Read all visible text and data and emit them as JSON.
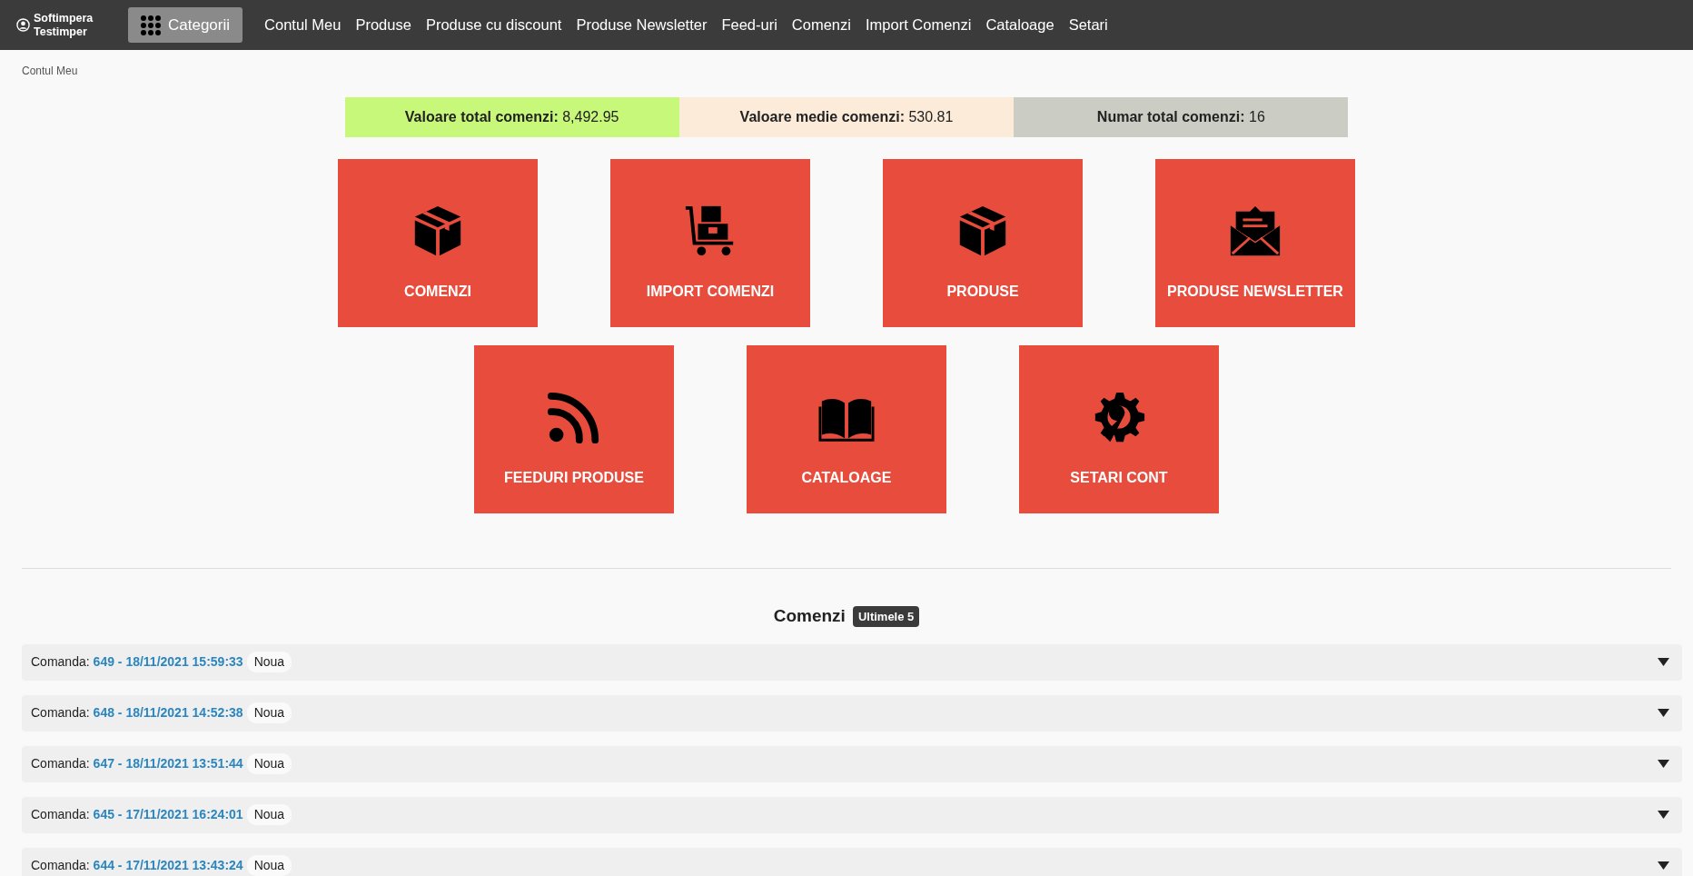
{
  "navbar": {
    "user": "Softimpera Testimper",
    "categories_button": "Categorii",
    "links": [
      "Contul Meu",
      "Produse",
      "Produse cu discount",
      "Produse Newsletter",
      "Feed-uri",
      "Comenzi",
      "Import Comenzi",
      "Cataloage",
      "Setari"
    ]
  },
  "breadcrumb": "Contul Meu",
  "stats": [
    {
      "label": "Valoare total comenzi:",
      "value": "8,492.95",
      "color": "#c8f87a"
    },
    {
      "label": "Valoare medie comenzi:",
      "value": "530.81",
      "color": "#fbebd8"
    },
    {
      "label": "Numar total comenzi:",
      "value": "16",
      "color": "#cbcdc4"
    }
  ],
  "tiles": [
    {
      "label": "COMENZI",
      "kind": "box"
    },
    {
      "label": "IMPORT COMENZI",
      "kind": "cart"
    },
    {
      "label": "PRODUSE",
      "kind": "box"
    },
    {
      "label": "PRODUSE NEWSLETTER",
      "kind": "envelope"
    },
    {
      "label": "FEEDURI PRODUSE",
      "kind": "rss"
    },
    {
      "label": "CATALOAGE",
      "kind": "book"
    },
    {
      "label": "SETARI CONT",
      "kind": "gear"
    }
  ],
  "orders": {
    "title": "Comenzi",
    "badge": "Ultimele 5",
    "rows": [
      {
        "prefix": "Comanda:",
        "link": "649 - 18/11/2021 15:59:33",
        "status": "Noua"
      },
      {
        "prefix": "Comanda:",
        "link": "648 - 18/11/2021 14:52:38",
        "status": "Noua"
      },
      {
        "prefix": "Comanda:",
        "link": "647 - 18/11/2021 13:51:44",
        "status": "Noua"
      },
      {
        "prefix": "Comanda:",
        "link": "645 - 17/11/2021 16:24:01",
        "status": "Noua"
      },
      {
        "prefix": "Comanda:",
        "link": "644 - 17/11/2021 13:43:24",
        "status": "Noua"
      }
    ]
  }
}
